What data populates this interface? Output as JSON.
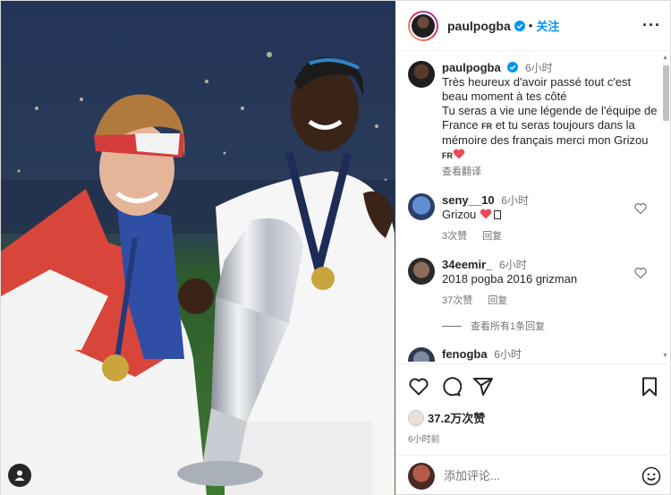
{
  "post": {
    "username": "paulpogba",
    "follow_label": "关注",
    "more_label": "···"
  },
  "caption": {
    "username": "paulpogba",
    "time": "6小时",
    "line1": "Très heureux d'avoir passé tout c'est beau moment à tes côté",
    "line2a": "Tu seras a vie une légende de l'équipe de France ",
    "flag1": "FR",
    "line2b": " et tu seras toujours dans la mémoire des français merci mon Grizou ",
    "flag2": "FR",
    "translate": "查看翻译"
  },
  "comments": [
    {
      "username": "seny__10",
      "time": "6小时",
      "text": "Grizou ",
      "likes": "3次赞",
      "reply": "回复"
    },
    {
      "username": "34eemir_",
      "time": "6小时",
      "text": "2018 pogba 2016 grizman",
      "likes": "37次赞",
      "reply": "回复"
    }
  ],
  "view_replies": "查看所有1条回复",
  "partial_comment": {
    "username": "fenogba",
    "time": "6小时"
  },
  "likes_count": "37.2万次赞",
  "post_time": "6小时前",
  "comment_placeholder": "添加评论...",
  "colors": {
    "follow": "#0095f6",
    "heart": "#ed4956",
    "verified": "#0095f6"
  }
}
